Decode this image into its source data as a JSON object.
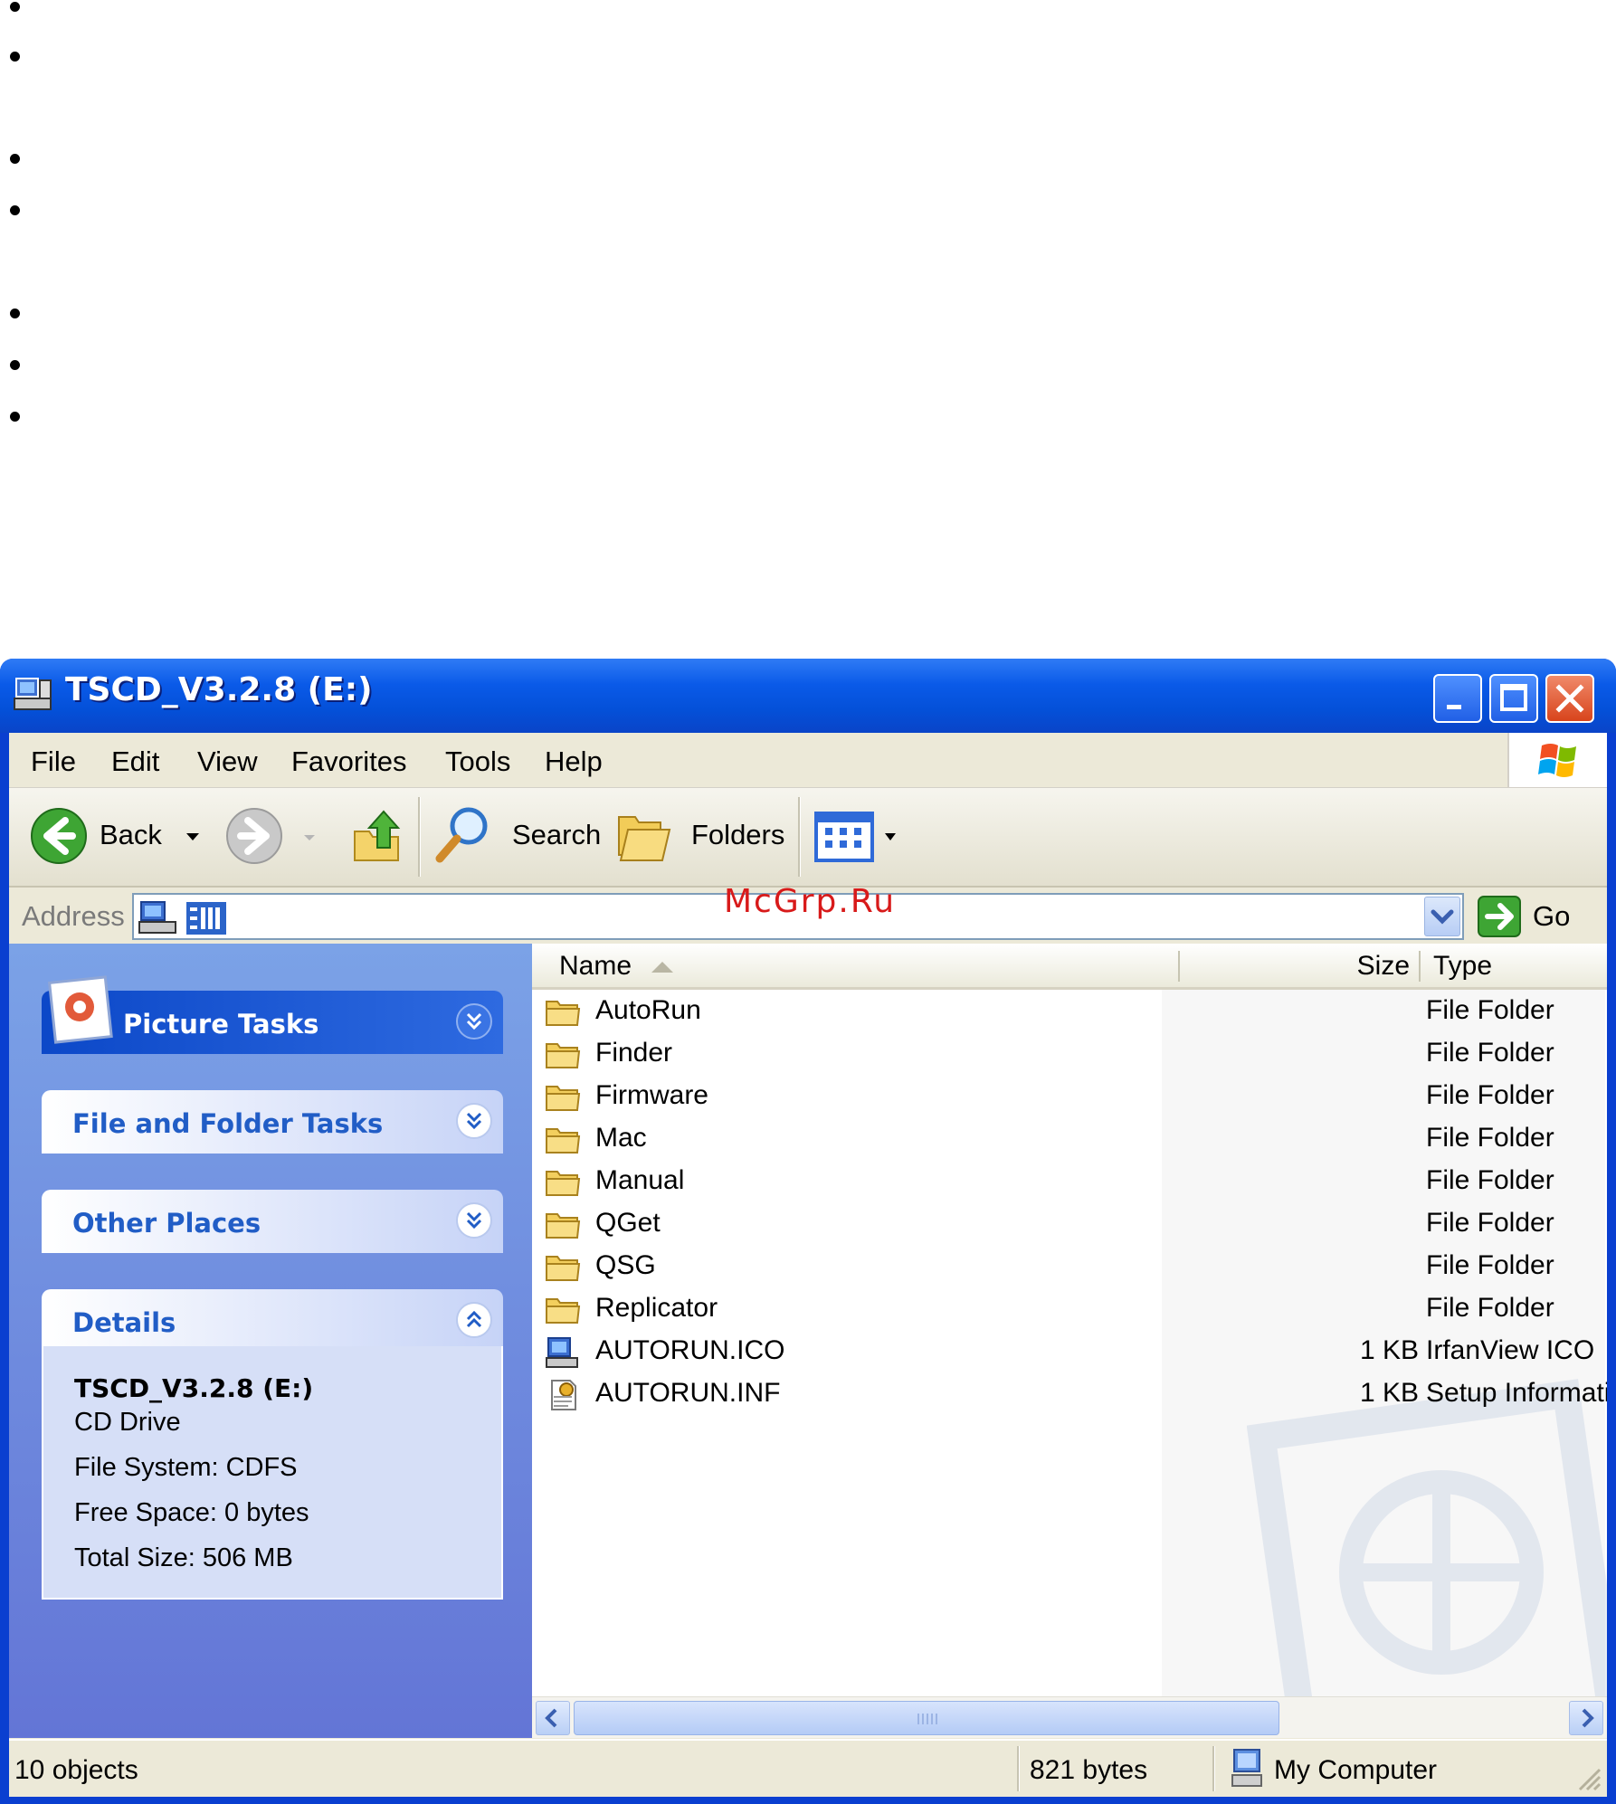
{
  "window": {
    "title": "TSCD_V3.2.8 (E:)"
  },
  "menu": [
    "File",
    "Edit",
    "View",
    "Favorites",
    "Tools",
    "Help"
  ],
  "toolbar": {
    "back_label": "Back",
    "search_label": "Search",
    "folders_label": "Folders"
  },
  "address": {
    "label": "Address",
    "go_label": "Go"
  },
  "watermark_text": "McGrp.Ru",
  "left_panels": {
    "picture_tasks": "Picture Tasks",
    "file_folder_tasks": "File and Folder Tasks",
    "other_places": "Other Places",
    "details": {
      "title": "Details",
      "name": "TSCD_V3.2.8 (E:)",
      "kind": "CD Drive",
      "file_system": "File System: CDFS",
      "free_space": "Free Space: 0 bytes",
      "total_size": "Total Size: 506 MB"
    }
  },
  "columns": {
    "name": "Name",
    "size": "Size",
    "type": "Type"
  },
  "files": [
    {
      "name": "AutoRun",
      "size": "",
      "type": "File Folder",
      "icon": "folder-icon"
    },
    {
      "name": "Finder",
      "size": "",
      "type": "File Folder",
      "icon": "folder-icon"
    },
    {
      "name": "Firmware",
      "size": "",
      "type": "File Folder",
      "icon": "folder-icon"
    },
    {
      "name": "Mac",
      "size": "",
      "type": "File Folder",
      "icon": "folder-icon"
    },
    {
      "name": "Manual",
      "size": "",
      "type": "File Folder",
      "icon": "folder-icon"
    },
    {
      "name": "QGet",
      "size": "",
      "type": "File Folder",
      "icon": "folder-icon"
    },
    {
      "name": "QSG",
      "size": "",
      "type": "File Folder",
      "icon": "folder-icon"
    },
    {
      "name": "Replicator",
      "size": "",
      "type": "File Folder",
      "icon": "folder-icon"
    },
    {
      "name": "AUTORUN.ICO",
      "size": "1 KB",
      "type": "IrfanView ICO",
      "icon": "ico-file-icon"
    },
    {
      "name": "AUTORUN.INF",
      "size": "1 KB",
      "type": "Setup Information",
      "icon": "inf-file-icon"
    }
  ],
  "status": {
    "objects": "10 objects",
    "size": "821 bytes",
    "location": "My Computer"
  },
  "colors": {
    "title_blue": "#0a5ae8",
    "panel_blue": "#215dc6",
    "close_red": "#d8441c"
  }
}
